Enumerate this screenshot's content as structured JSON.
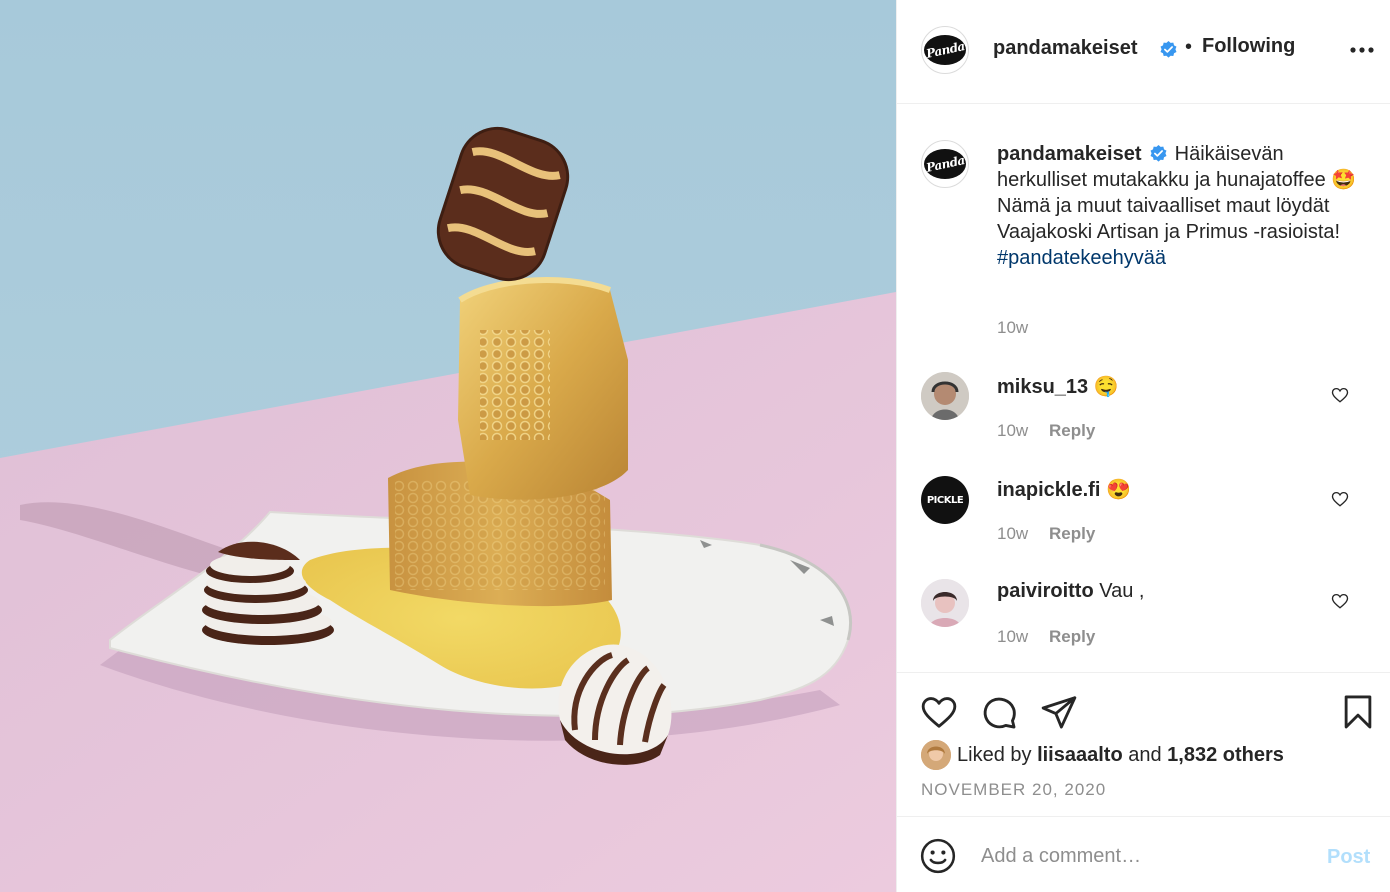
{
  "post_author": {
    "username": "pandamakeiset",
    "logo_text": "Panda",
    "verified_icon": "verified-badge-icon",
    "separator": "•",
    "follow_status": "Following"
  },
  "caption": {
    "username": "pandamakeiset",
    "text": "Häikäisevän herkulliset mutakakku ja hunajatoffee 🤩 Nämä ja muut taivaalliset maut löydät Vaajakoski Artisan ja Primus -rasioista!",
    "hashtag": "#pandatekeehyvää",
    "time": "10w"
  },
  "comments": [
    {
      "username": "miksu_13",
      "text": "🤤",
      "time": "10w",
      "reply_label": "Reply"
    },
    {
      "username": "inapickle.fi",
      "text": "😍",
      "time": "10w",
      "reply_label": "Reply",
      "avatar_text": "PICKLE"
    },
    {
      "username": "paiviroitto",
      "text": "Vau ,",
      "time": "10w",
      "reply_label": "Reply"
    }
  ],
  "likes": {
    "prefix": "Liked by",
    "user": "liisaaalto",
    "middle": "and",
    "others": "1,832 others"
  },
  "date": "NOVEMBER 20, 2020",
  "comment_box": {
    "placeholder": "Add a comment…",
    "post_label": "Post"
  },
  "colors": {
    "verified": "#3897f0",
    "hashtag": "#00376b",
    "secondary_text": "#8e8e8e",
    "post_disabled": "#b2dffc",
    "photo_wall": "#a9cad9",
    "photo_table": "#e9c4da"
  }
}
